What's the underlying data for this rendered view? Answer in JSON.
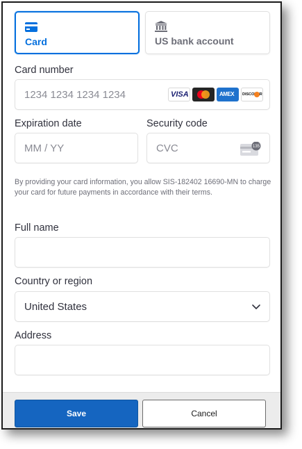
{
  "tabs": {
    "card": {
      "label": "Card",
      "icon": "credit-card-icon"
    },
    "bank": {
      "label": "US bank account",
      "icon": "bank-icon"
    }
  },
  "card_number": {
    "label": "Card number",
    "placeholder": "1234 1234 1234 1234",
    "brands": [
      {
        "name": "visa",
        "text": "VISA"
      },
      {
        "name": "mastercard",
        "text": ""
      },
      {
        "name": "amex",
        "text": "AMEX"
      },
      {
        "name": "discover",
        "text": "DISCOVER"
      }
    ]
  },
  "expiration": {
    "label": "Expiration date",
    "placeholder": "MM / YY"
  },
  "security": {
    "label": "Security code",
    "placeholder": "CVC",
    "icon_badge": "135"
  },
  "notice": "By providing your card information, you allow SIS-182402 16690-MN to charge your card for future payments in accordance with their terms.",
  "full_name": {
    "label": "Full name",
    "value": ""
  },
  "country": {
    "label": "Country or region",
    "value": "United States"
  },
  "address": {
    "label": "Address",
    "value": ""
  },
  "buttons": {
    "save": "Save",
    "cancel": "Cancel"
  },
  "colors": {
    "accent": "#0570de",
    "save_bg": "#1565c0",
    "footer_bg": "#ececec"
  }
}
